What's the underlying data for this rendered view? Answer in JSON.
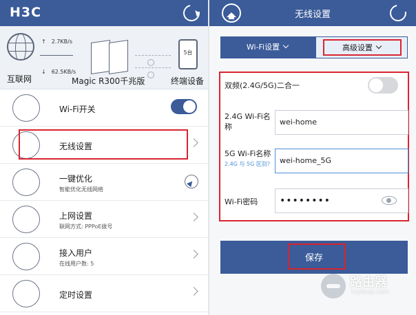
{
  "left": {
    "brand": "H3C",
    "status": {
      "internet_label": "互联网",
      "upload_speed": "2.7KB/s",
      "download_speed": "62.5KB/s",
      "router_label": "Magic R300千兆版",
      "devices_label": "终端设备",
      "devices_count": "5台"
    },
    "menu": [
      {
        "title": "Wi-Fi开关",
        "icon": "wifi-icon",
        "toggle_on": true
      },
      {
        "title": "无线设置",
        "icon": "wireless-settings-icon"
      },
      {
        "title": "一键优化",
        "subtitle": "智能优化无线网络",
        "icon": "optimize-icon"
      },
      {
        "title": "上网设置",
        "subtitle": "联网方式: PPPoE拨号",
        "icon": "internet-settings-icon"
      },
      {
        "title": "接入用户",
        "subtitle": "在线用户数: 5",
        "icon": "users-icon"
      },
      {
        "title": "定时设置",
        "icon": "timer-icon"
      }
    ]
  },
  "right": {
    "title": "无线设置",
    "tabs": {
      "wifi": "Wi-Fi设置",
      "advanced": "高级设置"
    },
    "form": {
      "dual_band_label": "双频(2.4G/5G)二合一",
      "dual_band_on": false,
      "name24_label": "2.4G Wi-Fi名称",
      "name24_value": "wei-home",
      "name5_label": "5G Wi-Fi名称",
      "name5_hint": "2.4G 与 5G 区别?",
      "name5_value": "wei-home_5G",
      "password_label": "Wi-Fi密码",
      "password_value": "••••••••"
    },
    "save_label": "保存"
  },
  "watermark": {
    "title": "路由器",
    "domain": "luyouqi.com"
  },
  "colors": {
    "primary": "#3b5b99",
    "highlight": "#d9242f",
    "hint": "#4b8fd8"
  }
}
